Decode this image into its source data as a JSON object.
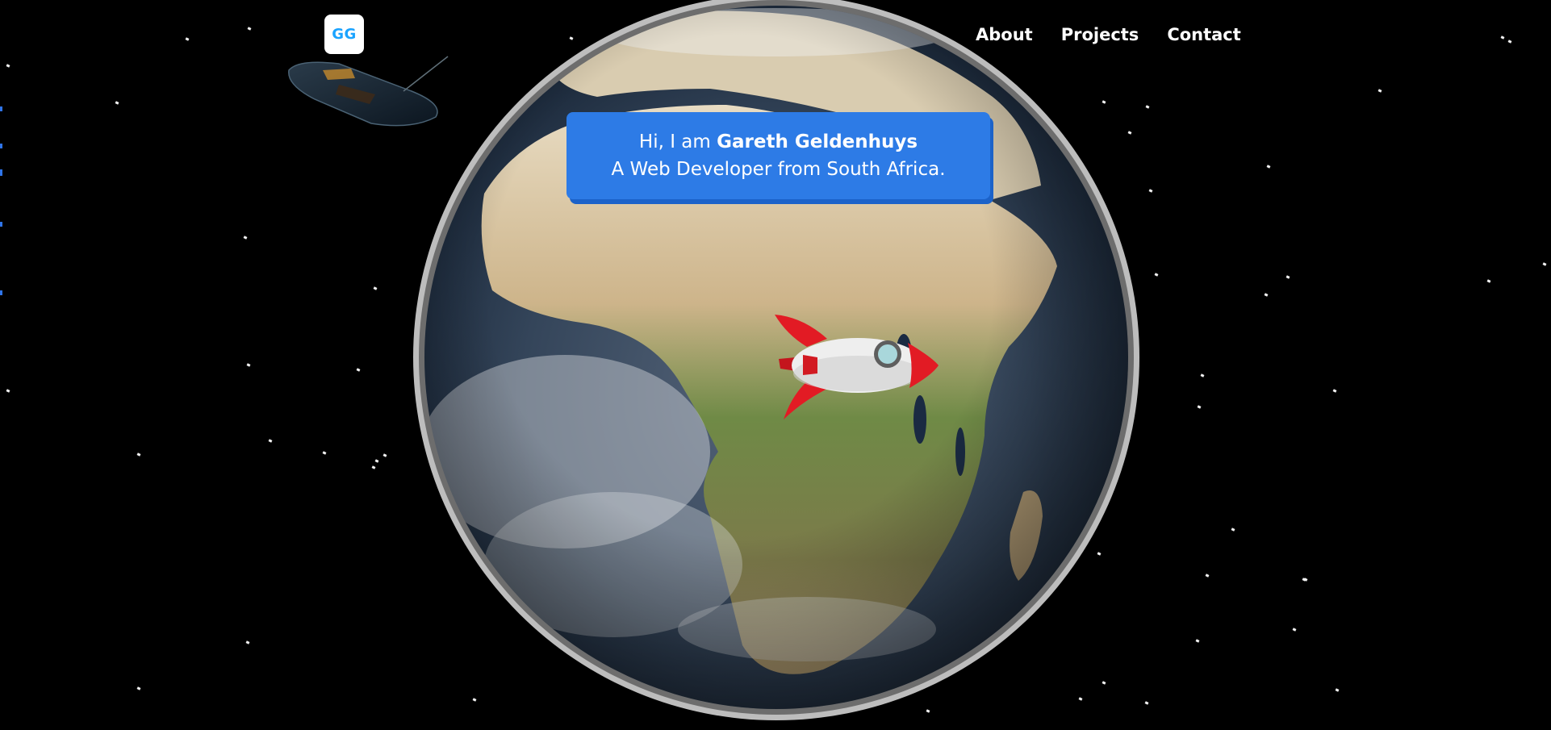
{
  "header": {
    "logo_text": "GG",
    "nav": [
      {
        "label": "About"
      },
      {
        "label": "Projects"
      },
      {
        "label": "Contact"
      }
    ]
  },
  "hero": {
    "greeting_prefix": "Hi, I am ",
    "name": "Gareth Geldenhuys",
    "tagline": "A Web Developer from South Africa."
  },
  "colors": {
    "background": "#000000",
    "card": "#2d7be6",
    "logo_text": "#1aa3ff",
    "nav_text": "#ffffff"
  },
  "icons": [
    "earth-globe",
    "rocket-model",
    "spaceship-saucer",
    "star-dots"
  ]
}
